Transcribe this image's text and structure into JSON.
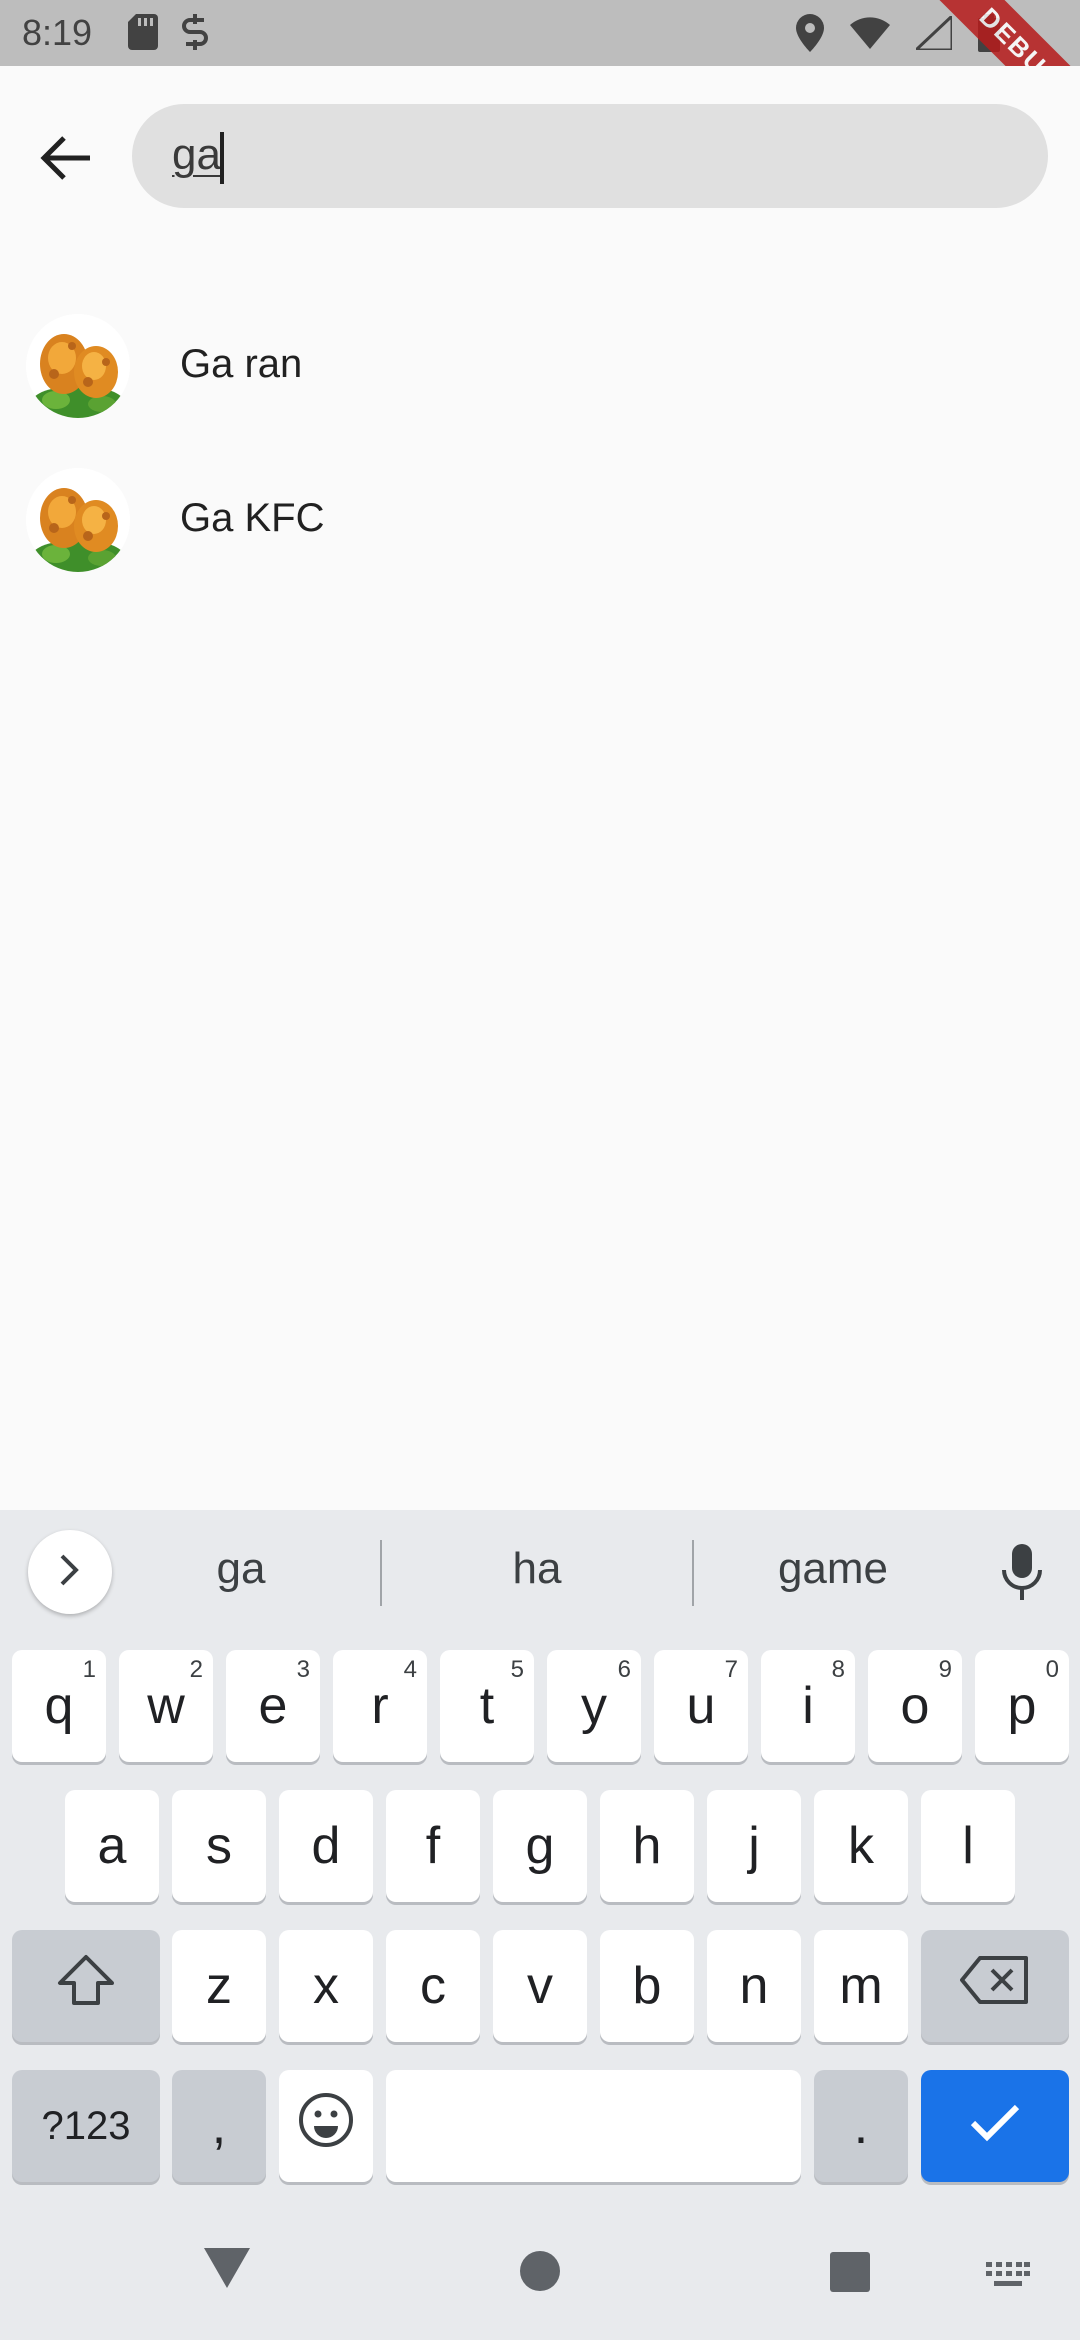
{
  "status_bar": {
    "time": "8:19",
    "left_icons": [
      "sd-card-icon",
      "sync-icon"
    ],
    "right_icons": [
      "location-icon",
      "wifi-icon",
      "signal-icon",
      "battery-icon"
    ],
    "debug_banner": "DEBUG"
  },
  "search": {
    "query": "ga",
    "back_icon": "arrow-back-icon"
  },
  "results": [
    {
      "label": "Ga ran",
      "image": "fried-chicken-image"
    },
    {
      "label": "Ga KFC",
      "image": "fried-chicken-image"
    }
  ],
  "keyboard": {
    "suggestions": [
      "ga",
      "ha",
      "game"
    ],
    "row1": [
      {
        "k": "q",
        "h": "1"
      },
      {
        "k": "w",
        "h": "2"
      },
      {
        "k": "e",
        "h": "3"
      },
      {
        "k": "r",
        "h": "4"
      },
      {
        "k": "t",
        "h": "5"
      },
      {
        "k": "y",
        "h": "6"
      },
      {
        "k": "u",
        "h": "7"
      },
      {
        "k": "i",
        "h": "8"
      },
      {
        "k": "o",
        "h": "9"
      },
      {
        "k": "p",
        "h": "0"
      }
    ],
    "row2": [
      "a",
      "s",
      "d",
      "f",
      "g",
      "h",
      "j",
      "k",
      "l"
    ],
    "row3": [
      "z",
      "x",
      "c",
      "v",
      "b",
      "n",
      "m"
    ],
    "symbols_label": "?123",
    "comma_label": ",",
    "period_label": ".",
    "accent_color": "#1a73e8"
  },
  "nav_bar": {
    "icons": [
      "back-triangle-icon",
      "home-circle-icon",
      "recents-square-icon",
      "keyboard-switch-icon"
    ]
  }
}
